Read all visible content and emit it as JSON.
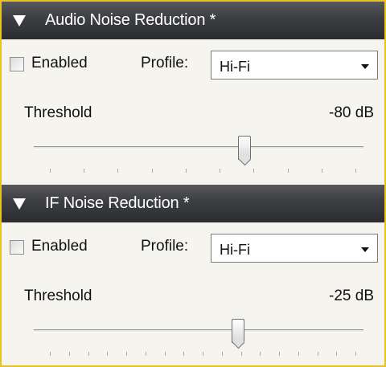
{
  "panels": [
    {
      "title": "Audio Noise Reduction *",
      "enabled_label": "Enabled",
      "enabled": false,
      "profile_label": "Profile:",
      "profile_value": "Hi-Fi",
      "threshold_label": "Threshold",
      "threshold_value": "-80 dB",
      "slider_level_fraction": 0.64,
      "tick_count": 10
    },
    {
      "title": "IF Noise Reduction *",
      "enabled_label": "Enabled",
      "enabled": false,
      "profile_label": "Profile:",
      "profile_value": "Hi-Fi",
      "threshold_label": "Threshold",
      "threshold_value": "-25 dB",
      "slider_level_fraction": 0.62,
      "tick_count": 17
    }
  ],
  "icons": {
    "collapse": "triangle-down-icon",
    "dropdown": "chevron-down-icon"
  },
  "colors": {
    "header_bg": "#3e4044",
    "panel_bg": "#f5f4ef",
    "border": "#e9c21c"
  }
}
